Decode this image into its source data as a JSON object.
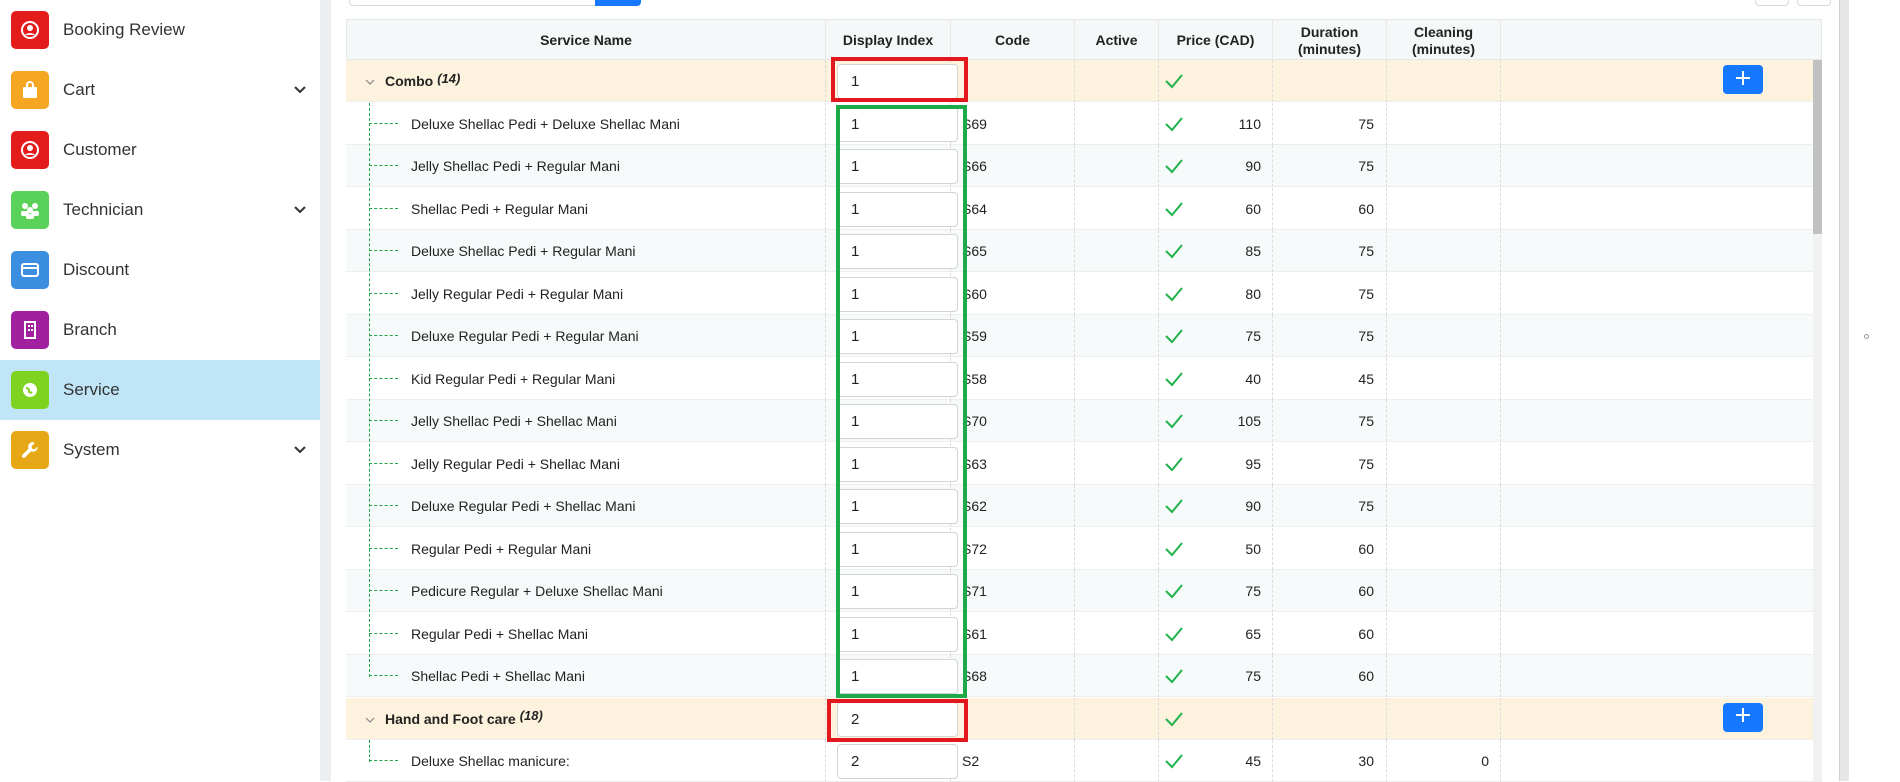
{
  "sidebar": {
    "items": [
      {
        "label": "Booking Review",
        "icon": "user-circle-icon",
        "color": "#e31b1b",
        "chevron": false,
        "active": false
      },
      {
        "label": "Cart",
        "icon": "shopping-bag-icon",
        "color": "#f5a623",
        "chevron": true,
        "active": false
      },
      {
        "label": "Customer",
        "icon": "user-circle-icon",
        "color": "#e31b1b",
        "chevron": false,
        "active": false
      },
      {
        "label": "Technician",
        "icon": "users-icon",
        "color": "#5ad25a",
        "chevron": true,
        "active": false
      },
      {
        "label": "Discount",
        "icon": "credit-card-icon",
        "color": "#3c8fe0",
        "chevron": false,
        "active": false
      },
      {
        "label": "Branch",
        "icon": "building-icon",
        "color": "#a020a0",
        "chevron": false,
        "active": false
      },
      {
        "label": "Service",
        "icon": "globe-icon",
        "color": "#7ed321",
        "chevron": false,
        "active": true
      },
      {
        "label": "System",
        "icon": "wrench-icon",
        "color": "#e6a817",
        "chevron": true,
        "active": false
      }
    ]
  },
  "table": {
    "headers": {
      "service_name": "Service Name",
      "display_index": "Display Index",
      "code": "Code",
      "active": "Active",
      "price": "Price (CAD)",
      "duration_line1": "Duration",
      "duration_line2": "(minutes)",
      "cleaning_line1": "Cleaning",
      "cleaning_line2": "(minutes)"
    },
    "groups": [
      {
        "name": "Combo",
        "count": "(14)",
        "display_index": "1",
        "active": true,
        "items": [
          {
            "name": "Deluxe Shellac Pedi + Deluxe Shellac Mani",
            "display_index": "1",
            "code": "S69",
            "active": true,
            "price": "110",
            "duration": "75",
            "cleaning": ""
          },
          {
            "name": "Jelly Shellac Pedi + Regular Mani",
            "display_index": "1",
            "code": "S66",
            "active": true,
            "price": "90",
            "duration": "75",
            "cleaning": ""
          },
          {
            "name": "Shellac Pedi + Regular Mani",
            "display_index": "1",
            "code": "S64",
            "active": true,
            "price": "60",
            "duration": "60",
            "cleaning": ""
          },
          {
            "name": "Deluxe Shellac Pedi + Regular Mani",
            "display_index": "1",
            "code": "S65",
            "active": true,
            "price": "85",
            "duration": "75",
            "cleaning": ""
          },
          {
            "name": "Jelly Regular Pedi + Regular Mani",
            "display_index": "1",
            "code": "S60",
            "active": true,
            "price": "80",
            "duration": "75",
            "cleaning": ""
          },
          {
            "name": "Deluxe Regular Pedi + Regular Mani",
            "display_index": "1",
            "code": "S59",
            "active": true,
            "price": "75",
            "duration": "75",
            "cleaning": ""
          },
          {
            "name": "Kid Regular Pedi + Regular Mani",
            "display_index": "1",
            "code": "S58",
            "active": true,
            "price": "40",
            "duration": "45",
            "cleaning": ""
          },
          {
            "name": "Jelly Shellac Pedi + Shellac Mani",
            "display_index": "1",
            "code": "S70",
            "active": true,
            "price": "105",
            "duration": "75",
            "cleaning": ""
          },
          {
            "name": "Jelly Regular Pedi + Shellac Mani",
            "display_index": "1",
            "code": "S63",
            "active": true,
            "price": "95",
            "duration": "75",
            "cleaning": ""
          },
          {
            "name": "Deluxe Regular Pedi + Shellac Mani",
            "display_index": "1",
            "code": "S62",
            "active": true,
            "price": "90",
            "duration": "75",
            "cleaning": ""
          },
          {
            "name": "Regular Pedi + Regular Mani",
            "display_index": "1",
            "code": "S72",
            "active": true,
            "price": "50",
            "duration": "60",
            "cleaning": ""
          },
          {
            "name": "Pedicure Regular + Deluxe Shellac Mani",
            "display_index": "1",
            "code": "S71",
            "active": true,
            "price": "75",
            "duration": "60",
            "cleaning": ""
          },
          {
            "name": "Regular Pedi + Shellac Mani",
            "display_index": "1",
            "code": "S61",
            "active": true,
            "price": "65",
            "duration": "60",
            "cleaning": ""
          },
          {
            "name": "Shellac Pedi + Shellac Mani",
            "display_index": "1",
            "code": "S68",
            "active": true,
            "price": "75",
            "duration": "60",
            "cleaning": ""
          }
        ]
      },
      {
        "name": "Hand and Foot care",
        "count": "(18)",
        "display_index": "2",
        "active": true,
        "items": [
          {
            "name": "Deluxe Shellac manicure:",
            "display_index": "2",
            "code": "S2",
            "active": true,
            "price": "45",
            "duration": "30",
            "cleaning": "0"
          }
        ]
      }
    ]
  },
  "colors": {
    "accent": "#1677ff",
    "check": "#22b24c",
    "highlight_red": "#e3171e",
    "highlight_green": "#1eaa48",
    "group_row": "#fdf2dd",
    "active_nav": "#bfe5f6"
  }
}
